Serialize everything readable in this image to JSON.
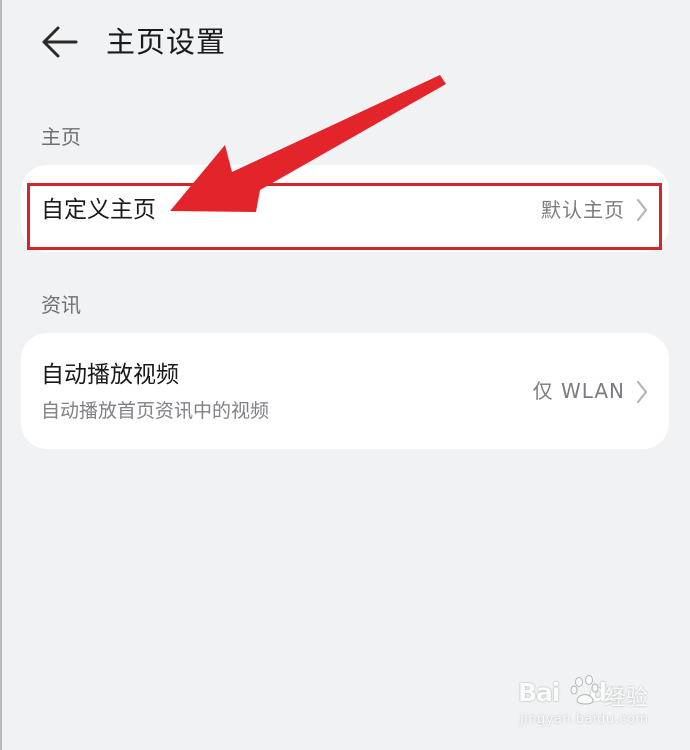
{
  "header": {
    "title": "主页设置",
    "back_icon": "arrow-left-icon"
  },
  "sections": [
    {
      "label": "主页",
      "items": [
        {
          "title": "自定义主页",
          "value": "默认主页",
          "icon": "chevron-right-icon"
        }
      ]
    },
    {
      "label": "资讯",
      "items": [
        {
          "title": "自动播放视频",
          "subtitle": "自动播放首页资讯中的视频",
          "value": "仅 WLAN",
          "icon": "chevron-right-icon"
        }
      ]
    }
  ],
  "annotation": {
    "highlight_color": "#d6242c",
    "arrow_color": "#e3242b",
    "arrow_icon": "red-annotation-arrow"
  },
  "watermark": {
    "logo_text": "Bai",
    "logo_text_2": "du",
    "cn_text": "经验",
    "url": "jingyan.baidu.com"
  },
  "colors": {
    "background": "#f1f2f4",
    "card": "#ffffff",
    "secondary_text": "#808185"
  }
}
